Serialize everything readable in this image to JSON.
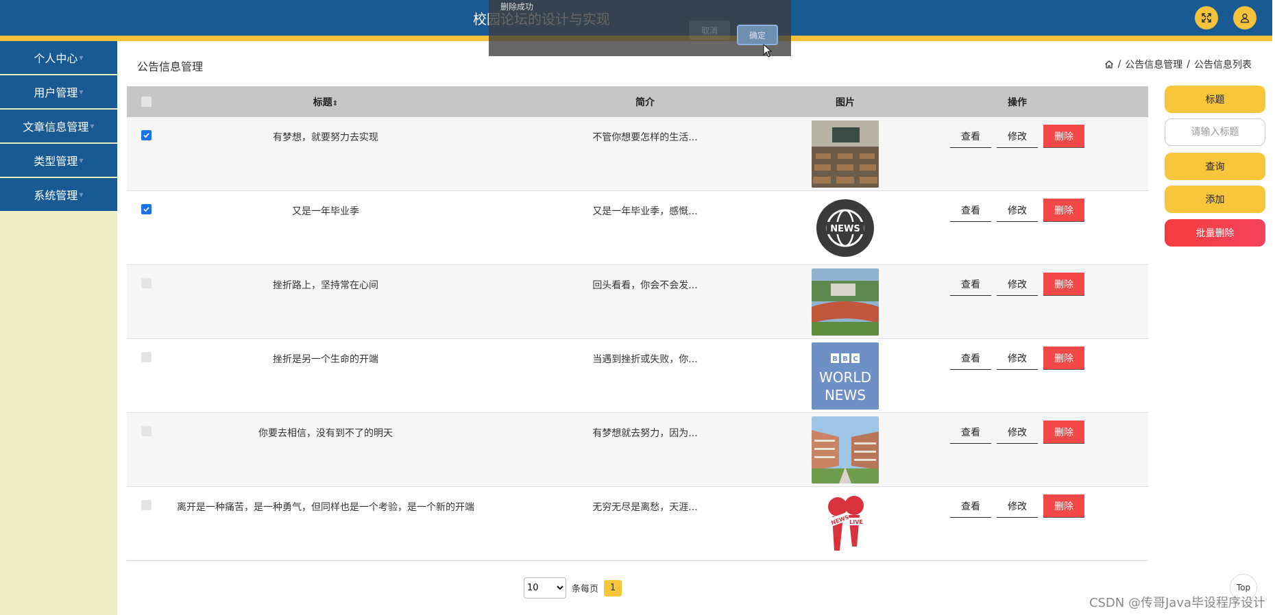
{
  "app": {
    "title": "校园论坛的设计与实现"
  },
  "sidebar": {
    "items": [
      {
        "label": "个人中心"
      },
      {
        "label": "用户管理"
      },
      {
        "label": "文章信息管理"
      },
      {
        "label": "类型管理"
      },
      {
        "label": "系统管理"
      }
    ]
  },
  "page": {
    "title": "公告信息管理"
  },
  "breadcrumb": {
    "home_icon": "home-icon",
    "sep": "/",
    "level1": "公告信息管理",
    "level2": "公告信息列表"
  },
  "table": {
    "headers": {
      "title": "标题",
      "intro": "简介",
      "image": "图片",
      "ops": "操作"
    },
    "rows": [
      {
        "checked": true,
        "title": "有梦想，就要努力去实现",
        "intro": "不管你想要怎样的生活...",
        "image": "classroom-image"
      },
      {
        "checked": true,
        "title": "又是一年毕业季",
        "intro": "又是一年毕业季，感慨...",
        "image": "news-globe-image"
      },
      {
        "checked": false,
        "title": "挫折路上，坚持常在心间",
        "intro": "回头看看，你会不会发...",
        "image": "sports-field-image"
      },
      {
        "checked": false,
        "title": "挫折是另一个生命的开端",
        "intro": "当遇到挫折或失败，你...",
        "image": "bbc-world-news-image"
      },
      {
        "checked": false,
        "title": "你要去相信，没有到不了的明天",
        "intro": "有梦想就去努力，因为...",
        "image": "campus-building-image"
      },
      {
        "checked": false,
        "title": "离开是一种痛苦，是一种勇气，但同样也是一个考验，是一个新的开端",
        "intro": "无穷无尽是离愁，天涯...",
        "image": "news-microphones-image"
      }
    ],
    "ops": {
      "view": "查看",
      "edit": "修改",
      "delete": "删除"
    }
  },
  "right_panel": {
    "field_label": "标题",
    "search_placeholder": "请输入标题",
    "query": "查询",
    "add": "添加",
    "batch_delete": "批量删除"
  },
  "pagination": {
    "page_size": "10",
    "per_page_label": "条每页",
    "current_page": "1"
  },
  "top_button": "Top",
  "watermark": "CSDN @传哥Java毕设程序设计",
  "toast": {
    "message": "删除成功",
    "confirm": "确定",
    "cancel": "取消"
  },
  "colors": {
    "header": "#1a5a94",
    "accent": "#f7c63a",
    "danger": "#f24848",
    "sidebar_bg": "#eeeec4"
  }
}
